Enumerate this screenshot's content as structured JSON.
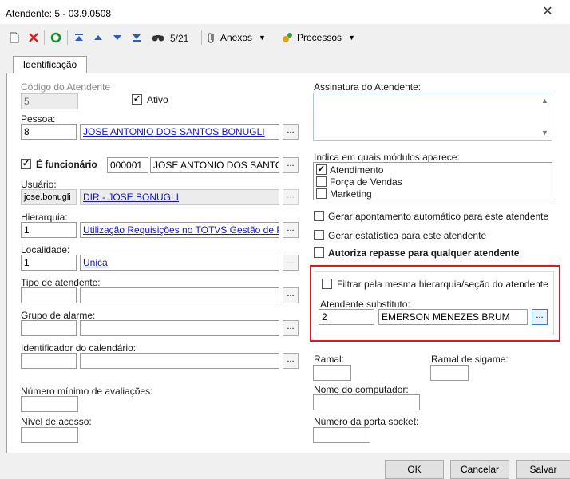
{
  "window": {
    "title": "Atendente: 5 - 03.9.0508",
    "close_glyph": "✕"
  },
  "toolbar": {
    "record_counter": "5/21",
    "attachments_label": "Anexos",
    "processes_label": "Processos"
  },
  "tabs": [
    {
      "label": "Identificação"
    }
  ],
  "form": {
    "codigo": {
      "label": "Código do Atendente",
      "value": "5"
    },
    "ativo": {
      "label": "Ativo",
      "checked": true
    },
    "pessoa": {
      "label": "Pessoa:",
      "code": "8",
      "name": "JOSE ANTONIO DOS SANTOS BONUGLI"
    },
    "funcionario": {
      "label": "É funcionário",
      "checked": true,
      "code": "000001",
      "name": "JOSE ANTONIO DOS SANTOS"
    },
    "usuario": {
      "label": "Usuário:",
      "login": "jose.bonugli",
      "name": "DIR - JOSE BONUGLI"
    },
    "hierarquia": {
      "label": "Hierarquia:",
      "code": "1",
      "name": "Utilização Requisições no TOTVS Gestão de Pesso"
    },
    "localidade": {
      "label": "Localidade:",
      "code": "1",
      "name": "Unica"
    },
    "tipo": {
      "label": "Tipo de atendente:",
      "code": "",
      "name": ""
    },
    "grupo_alarme": {
      "label": "Grupo de alarme:",
      "code": "",
      "name": ""
    },
    "calendario": {
      "label": "Identificador do calendário:",
      "code": "",
      "name": ""
    },
    "min_avaliacoes": {
      "label": "Número mínimo de avaliações:",
      "value": ""
    },
    "nivel_acesso": {
      "label": "Nível de acesso:",
      "value": ""
    },
    "assinatura": {
      "label": "Assinatura do Atendente:",
      "value": ""
    },
    "modulos": {
      "label": "Indica em quais módulos aparece:",
      "items": [
        {
          "label": "Atendimento",
          "checked": true
        },
        {
          "label": "Força de Vendas",
          "checked": false
        },
        {
          "label": "Marketing",
          "checked": false
        }
      ]
    },
    "gerar_apontamento": {
      "label": "Gerar apontamento automático para este atendente",
      "checked": false
    },
    "gerar_estatistica": {
      "label": "Gerar estatística para este atendente",
      "checked": false
    },
    "autoriza_repasse": {
      "label": "Autoriza repasse para qualquer atendente",
      "checked": false
    },
    "filtrar_hierarquia": {
      "label": "Filtrar pela mesma hierarquia/seção do atendente",
      "checked": false
    },
    "substituto": {
      "label": "Atendente substituto:",
      "code": "2",
      "name": "EMERSON MENEZES BRUM"
    },
    "ramal": {
      "label": "Ramal:",
      "value": ""
    },
    "ramal_sigame": {
      "label": "Ramal de sigame:",
      "value": ""
    },
    "computador": {
      "label": "Nome do computador:",
      "value": ""
    },
    "porta_socket": {
      "label": "Número da porta socket:",
      "value": ""
    },
    "lookup_glyph": "..."
  },
  "footer": {
    "ok_label": "OK",
    "cancel_label": "Cancelar",
    "save_label": "Salvar"
  }
}
